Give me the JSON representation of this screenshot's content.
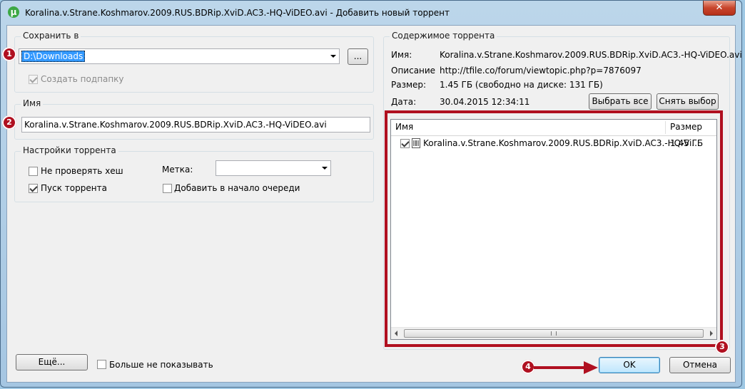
{
  "window": {
    "title": "Koralina.v.Strane.Koshmarov.2009.RUS.BDRip.XviD.AC3.-HQ-ViDEO.avi - Добавить новый торрент",
    "app_icon": "µ",
    "close_glyph": "✕"
  },
  "save_in": {
    "group_label": "Сохранить в",
    "path": "D:\\Downloads",
    "browse_label": "...",
    "create_subfolder_label": "Создать подпапку",
    "create_subfolder_checked": true,
    "create_subfolder_enabled": false
  },
  "name_group": {
    "label": "Имя",
    "value": "Koralina.v.Strane.Koshmarov.2009.RUS.BDRip.XviD.AC3.-HQ-ViDEO.avi"
  },
  "torrent_settings": {
    "group_label": "Настройки торрента",
    "skip_hash_label": "Не проверять хеш",
    "skip_hash_checked": false,
    "start_torrent_label": "Пуск торрента",
    "start_torrent_checked": true,
    "tag_label": "Метка:",
    "tag_value": "",
    "add_to_top_label": "Добавить в начало очереди",
    "add_to_top_checked": false
  },
  "contents": {
    "group_label": "Содержимое торрента",
    "name_label": "Имя:",
    "name_value": "Koralina.v.Strane.Koshmarov.2009.RUS.BDRip.XviD.AC3.-HQ-ViDEO.avi",
    "desc_label": "Описание",
    "desc_value": "http://tfile.co/forum/viewtopic.php?p=7876097",
    "size_label": "Размер:",
    "size_value": "1.45 ГБ (свободно на диске: 131 ГБ)",
    "date_label": "Дата:",
    "date_value": "30.04.2015 12:34:11",
    "select_all_label": "Выбрать все",
    "deselect_label": "Снять выбор",
    "columns": [
      "Имя",
      "Размер"
    ],
    "files": [
      {
        "name": "Koralina.v.Strane.Koshmarov.2009.RUS.BDRip.XviD.AC3.-HQ-Vi...",
        "size": "1.45 ГБ",
        "checked": true
      }
    ]
  },
  "footer": {
    "more_label": "Ещё...",
    "dont_show_label": "Больше не показывать",
    "dont_show_checked": false,
    "ok_label": "OK",
    "cancel_label": "Отмена"
  },
  "annotations": {
    "badges": [
      "1",
      "2",
      "3",
      "4"
    ],
    "color": "#b01020"
  }
}
